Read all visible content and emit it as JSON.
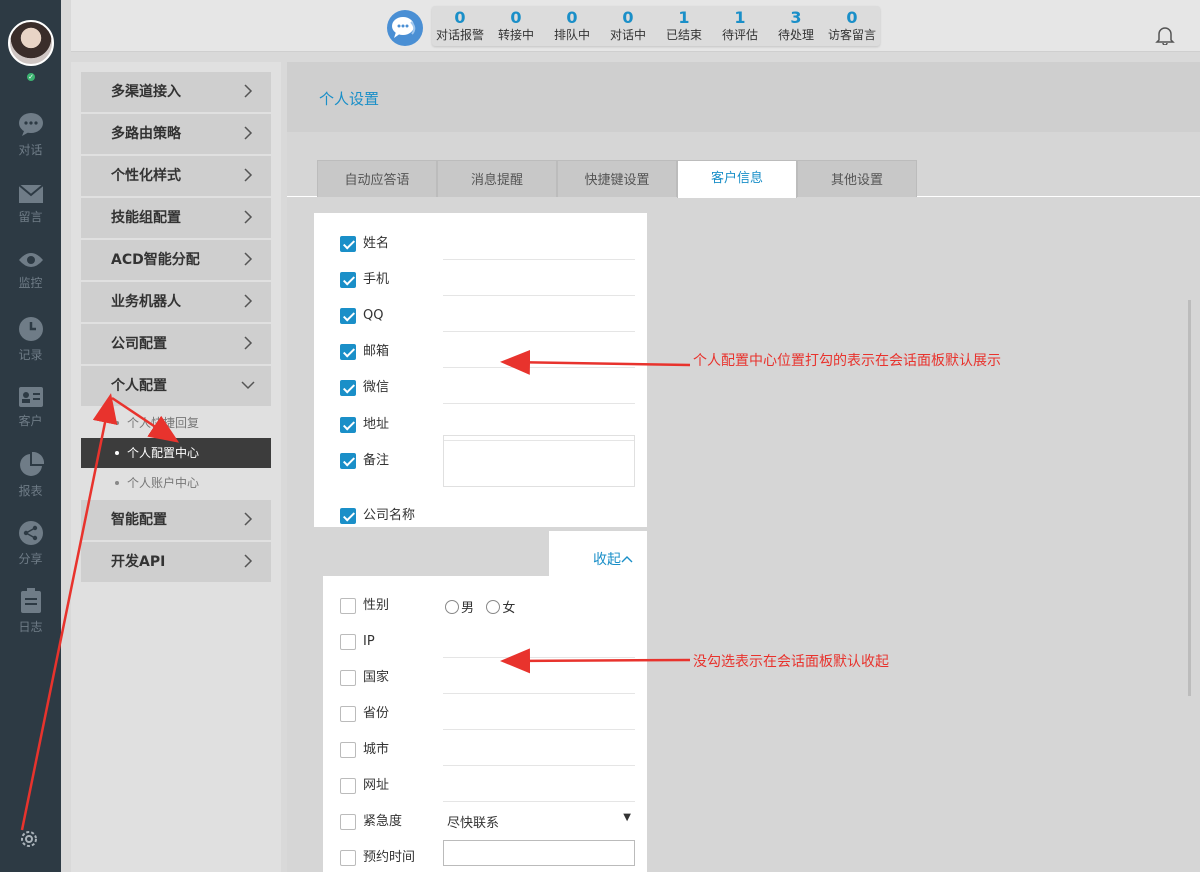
{
  "rail": {
    "items": [
      {
        "label": "对话",
        "icon": "chat-icon"
      },
      {
        "label": "留言",
        "icon": "mail-icon"
      },
      {
        "label": "监控",
        "icon": "eye-icon"
      },
      {
        "label": "记录",
        "icon": "clock-icon"
      },
      {
        "label": "客户",
        "icon": "contact-card-icon"
      },
      {
        "label": "报表",
        "icon": "pie-chart-icon"
      },
      {
        "label": "分享",
        "icon": "share-icon"
      },
      {
        "label": "日志",
        "icon": "clipboard-icon"
      }
    ]
  },
  "stats": [
    {
      "value": "0",
      "label": "对话报警"
    },
    {
      "value": "0",
      "label": "转接中"
    },
    {
      "value": "0",
      "label": "排队中"
    },
    {
      "value": "0",
      "label": "对话中"
    },
    {
      "value": "1",
      "label": "已结束"
    },
    {
      "value": "1",
      "label": "待评估"
    },
    {
      "value": "3",
      "label": "待处理"
    },
    {
      "value": "0",
      "label": "访客留言"
    }
  ],
  "menu": {
    "items": [
      {
        "label": "多渠道接入"
      },
      {
        "label": "多路由策略"
      },
      {
        "label": "个性化样式"
      },
      {
        "label": "技能组配置"
      },
      {
        "label": "ACD智能分配"
      },
      {
        "label": "业务机器人"
      },
      {
        "label": "公司配置"
      },
      {
        "label": "个人配置"
      }
    ],
    "sub_items": [
      {
        "label": "个人快捷回复"
      },
      {
        "label": "个人配置中心"
      },
      {
        "label": "个人账户中心"
      }
    ],
    "items_after": [
      {
        "label": "智能配置"
      },
      {
        "label": "开发API"
      }
    ]
  },
  "page": {
    "title": "个人设置"
  },
  "tabs": [
    {
      "label": "自动应答语"
    },
    {
      "label": "消息提醒"
    },
    {
      "label": "快捷键设置"
    },
    {
      "label": "客户信息"
    },
    {
      "label": "其他设置"
    }
  ],
  "checked_fields": [
    {
      "label": "姓名"
    },
    {
      "label": "手机"
    },
    {
      "label": "QQ"
    },
    {
      "label": "邮箱"
    },
    {
      "label": "微信"
    },
    {
      "label": "地址"
    },
    {
      "label": "备注"
    },
    {
      "label": "公司名称"
    }
  ],
  "collapse_label": "收起",
  "unchecked_fields": [
    {
      "label": "性别"
    },
    {
      "label": "IP"
    },
    {
      "label": "国家"
    },
    {
      "label": "省份"
    },
    {
      "label": "城市"
    },
    {
      "label": "网址"
    },
    {
      "label": "紧急度"
    },
    {
      "label": "预约时间"
    }
  ],
  "gender_options": [
    "男",
    "女"
  ],
  "urgency_value": "尽快联系",
  "annotations": {
    "checked": "个人配置中心位置打勾的表示在会话面板默认展示",
    "unchecked": "没勾选表示在会话面板默认收起"
  },
  "colors": {
    "accent": "#1a8fc8",
    "annotation": "#e8332d",
    "rail": "#2d3a44"
  }
}
